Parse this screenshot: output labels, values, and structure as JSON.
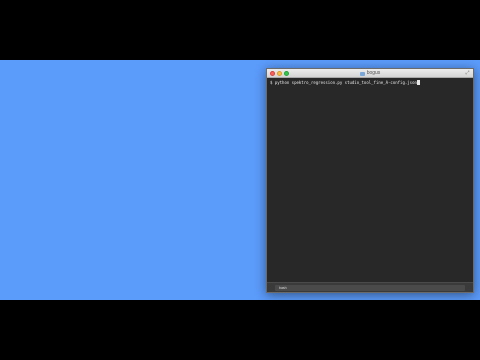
{
  "window": {
    "title": "bogus",
    "icons": {
      "close": "close-traffic-light",
      "minimize": "minimize-traffic-light",
      "zoom": "zoom-traffic-light",
      "folder": "folder-icon",
      "fullscreen": "fullscreen-icon"
    }
  },
  "terminal": {
    "prompt_line": "$ python spektro_regression.py studio_tool_fine_A-config.json"
  },
  "statusbar": {
    "tab_label": "bash"
  },
  "colors": {
    "desktop": "#5b9bfa",
    "terminal_bg": "#282828",
    "close": "#fc605c",
    "minimize": "#fdbc40",
    "zoom": "#34c84a"
  }
}
